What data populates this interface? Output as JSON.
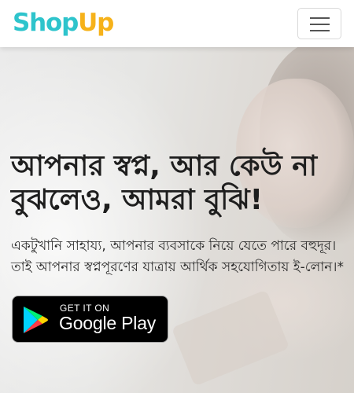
{
  "brand": {
    "part1": "Shop",
    "part2": "Up",
    "colors": {
      "shop": "#2ec4cc",
      "up": "#f6b21a"
    }
  },
  "navbar": {
    "menu_icon": "hamburger-menu-icon"
  },
  "hero": {
    "headline": "আপনার স্বপ্ন, আর কেউ না বুঝলেও, আমরা বুঝি!",
    "subtext": "একটুখানি সাহায্য, আপনার ব্যবসাকে নিয়ে যেতে পারে বহুদূর। তাই আপনার স্বপ্নপূরণের যাত্রায় আর্থিক সহযোগিতায় ই-লোন।*"
  },
  "store_badge": {
    "small_text": "GET IT ON",
    "large_text": "Google Play",
    "icon": "google-play-icon"
  }
}
